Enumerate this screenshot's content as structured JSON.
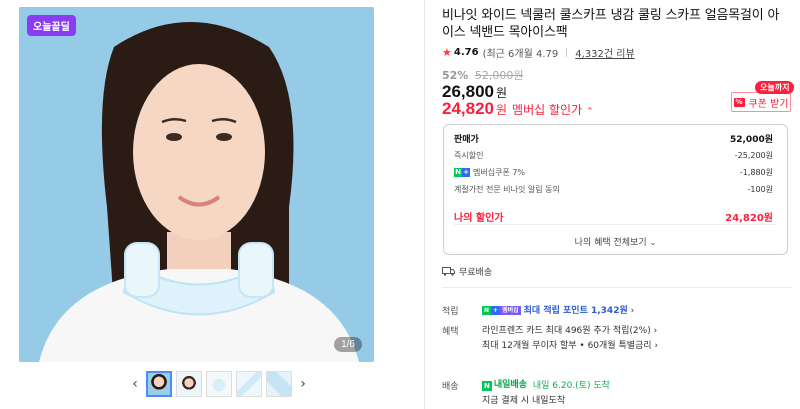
{
  "gallery": {
    "badge": "오늘끝딜",
    "page_indicator": "1/6",
    "prev_arrow": "‹",
    "next_arrow": "›",
    "thumbnails": [
      "thumbnail-1",
      "thumbnail-2",
      "thumbnail-3",
      "thumbnail-4",
      "thumbnail-5"
    ]
  },
  "product": {
    "title": "비나잇 와이드 넥쿨러 쿨스카프 냉감 쿨링 스카프 얼음목걸이 아이스 넥밴드 목아이스팩",
    "rating": "4.76",
    "rating_recent": "(최근 6개월 4.79",
    "review_count": "4,332건 리뷰",
    "discount_rate": "52%",
    "original_price": "52,000원",
    "price": "26,800",
    "price_unit": "원",
    "member_price": "24,820",
    "member_unit": "원",
    "member_label": "멤버십 할인가",
    "member_caret": "⌃"
  },
  "coupon": {
    "tag": "오늘까지",
    "icon": "%",
    "label": "쿠폰 받기"
  },
  "breakdown": {
    "sale_label": "판매가",
    "sale_value": "52,000원",
    "instant_label": "즉시할인",
    "instant_value": "-25,200원",
    "membership_label": "멤버십쿠폰 7%",
    "membership_value": "-1,880원",
    "consent_label": "계절가전 전문 비나잇 알림 동의",
    "consent_value": "-100원",
    "total_label": "나의 할인가",
    "total_value": "24,820원",
    "benefit_link": "나의 혜택 전체보기",
    "benefit_caret": "⌄"
  },
  "shipping": {
    "free": "무료배송"
  },
  "details": {
    "points_label": "적립",
    "points_badge_m": "멤버십",
    "points_text": "최대 적립 포인트 1,342원",
    "points_caret": "›",
    "benefit_label": "혜택",
    "benefit_line1": "라인프렌즈 카드 최대 496원 추가 적립(2%)",
    "benefit_line2": "최대 12개월 무이자 할부 • 60개월 특별금리",
    "benefit_caret": "›",
    "delivery_label": "배송",
    "delivery_badge": "내일배송",
    "delivery_date": "내일 6.20.(토) 도착",
    "delivery_note": "지금 결제 시 내일도착"
  },
  "colors": {
    "accent_red": "#ff1e3c",
    "naver_green": "#03c75a",
    "pay_blue": "#2d6cf5",
    "badge_purple": "#8a3cf2"
  }
}
